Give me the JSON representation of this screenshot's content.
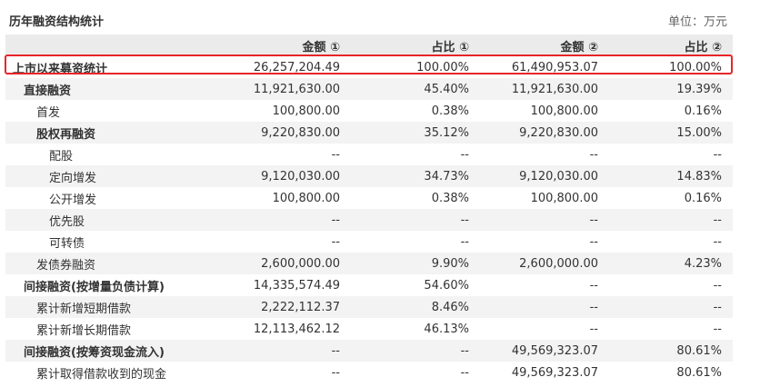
{
  "title": "历年融资结构统计",
  "unit": "单位：万元",
  "headers": [
    "",
    "金额 ①",
    "占比 ①",
    "金额 ②",
    "占比 ②"
  ],
  "rows": [
    {
      "label": "上市以来募资统计",
      "v1": "26,257,204.49",
      "p1": "100.00%",
      "v2": "61,490,953.07",
      "p2": "100.00%"
    },
    {
      "label": "直接融资",
      "v1": "11,921,630.00",
      "p1": "45.40%",
      "v2": "11,921,630.00",
      "p2": "19.39%"
    },
    {
      "label": "首发",
      "v1": "100,800.00",
      "p1": "0.38%",
      "v2": "100,800.00",
      "p2": "0.16%"
    },
    {
      "label": "股权再融资",
      "v1": "9,220,830.00",
      "p1": "35.12%",
      "v2": "9,220,830.00",
      "p2": "15.00%"
    },
    {
      "label": "配股",
      "v1": "--",
      "p1": "--",
      "v2": "--",
      "p2": "--"
    },
    {
      "label": "定向增发",
      "v1": "9,120,030.00",
      "p1": "34.73%",
      "v2": "9,120,030.00",
      "p2": "14.83%"
    },
    {
      "label": "公开增发",
      "v1": "100,800.00",
      "p1": "0.38%",
      "v2": "100,800.00",
      "p2": "0.16%"
    },
    {
      "label": "优先股",
      "v1": "--",
      "p1": "--",
      "v2": "--",
      "p2": "--"
    },
    {
      "label": "可转债",
      "v1": "--",
      "p1": "--",
      "v2": "--",
      "p2": "--"
    },
    {
      "label": "发债券融资",
      "v1": "2,600,000.00",
      "p1": "9.90%",
      "v2": "2,600,000.00",
      "p2": "4.23%"
    },
    {
      "label": "间接融资(按增量负债计算)",
      "v1": "14,335,574.49",
      "p1": "54.60%",
      "v2": "--",
      "p2": "--"
    },
    {
      "label": "累计新增短期借款",
      "v1": "2,222,112.37",
      "p1": "8.46%",
      "v2": "--",
      "p2": "--"
    },
    {
      "label": "累计新增长期借款",
      "v1": "12,113,462.12",
      "p1": "46.13%",
      "v2": "--",
      "p2": "--"
    },
    {
      "label": "间接融资(按筹资现金流入)",
      "v1": "--",
      "p1": "--",
      "v2": "49,569,323.07",
      "p2": "80.61%"
    },
    {
      "label": "累计取得借款收到的现金",
      "v1": "--",
      "p1": "--",
      "v2": "49,569,323.07",
      "p2": "80.61%"
    }
  ]
}
